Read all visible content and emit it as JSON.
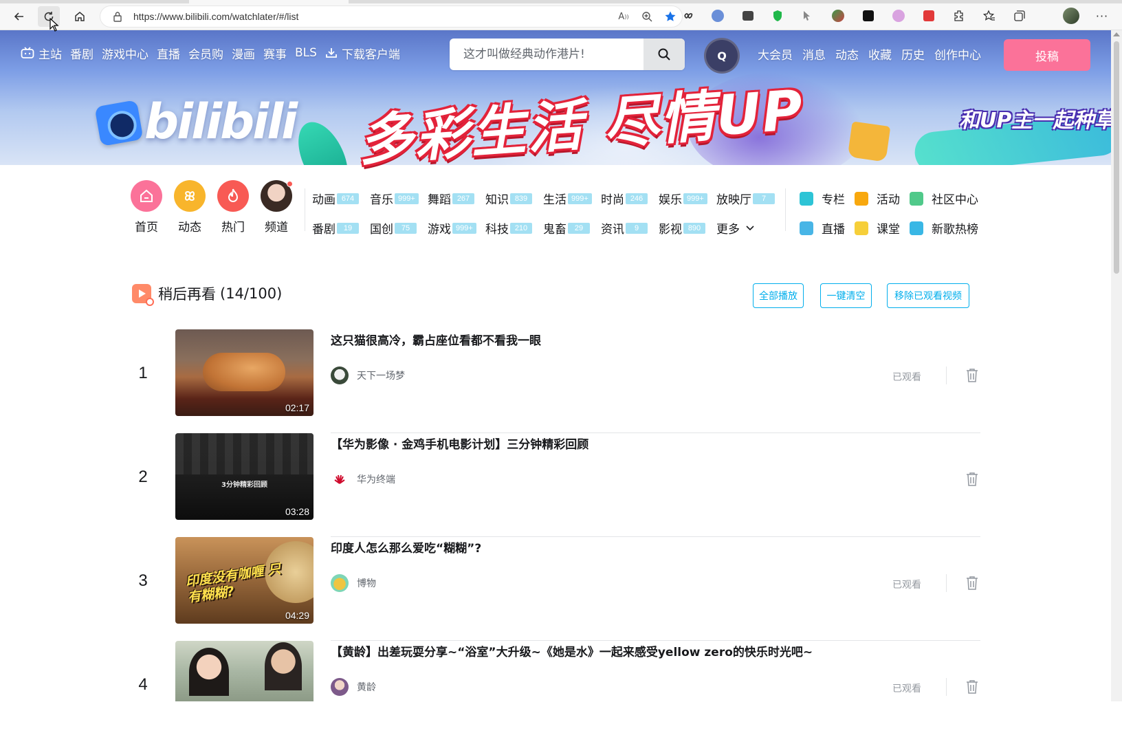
{
  "browser": {
    "url": "https://www.bilibili.com/watchlater/#/list"
  },
  "header": {
    "nav": [
      "主站",
      "番剧",
      "游戏中心",
      "直播",
      "会员购",
      "漫画",
      "赛事",
      "BLS",
      "下载客户端"
    ],
    "search_placeholder": "这才叫做经典动作港片!",
    "right_nav": [
      "大会员",
      "消息",
      "动态",
      "收藏",
      "历史",
      "创作中心"
    ],
    "upload_label": "投稿",
    "banner_logo": "bilibili",
    "banner_slogan": "多彩生活 尽情UP",
    "banner_side": "和UP主一起种草",
    "avatar_text": "Q"
  },
  "quick_links": [
    {
      "label": "首页",
      "color": "#fb7299"
    },
    {
      "label": "动态",
      "color": "#f8b52c"
    },
    {
      "label": "热门",
      "color": "#f85a54"
    },
    {
      "label": "频道",
      "color": "#8a6e62"
    }
  ],
  "categories_row1": [
    {
      "name": "动画",
      "count": "674"
    },
    {
      "name": "音乐",
      "count": "999+"
    },
    {
      "name": "舞蹈",
      "count": "267"
    },
    {
      "name": "知识",
      "count": "839"
    },
    {
      "name": "生活",
      "count": "999+"
    },
    {
      "name": "时尚",
      "count": "246"
    },
    {
      "name": "娱乐",
      "count": "999+"
    },
    {
      "name": "放映厅",
      "count": "7"
    }
  ],
  "categories_row2": [
    {
      "name": "番剧",
      "count": "19"
    },
    {
      "name": "国创",
      "count": "75"
    },
    {
      "name": "游戏",
      "count": "999+"
    },
    {
      "name": "科技",
      "count": "210"
    },
    {
      "name": "鬼畜",
      "count": "29"
    },
    {
      "name": "资讯",
      "count": "9"
    },
    {
      "name": "影视",
      "count": "890"
    }
  ],
  "more_label": "更多",
  "right_links": [
    {
      "label": "专栏",
      "color": "#2dc4d6"
    },
    {
      "label": "活动",
      "color": "#f8a80e"
    },
    {
      "label": "社区中心",
      "color": "#50c98a"
    },
    {
      "label": "直播",
      "color": "#48b5e6"
    },
    {
      "label": "课堂",
      "color": "#f6cf3a"
    },
    {
      "label": "新歌热榜",
      "color": "#39b7e5"
    }
  ],
  "watchlater": {
    "title": "稍后再看",
    "count": "(14/100)",
    "buttons": {
      "play_all": "全部播放",
      "clear": "一键清空",
      "remove_watched": "移除已观看视频"
    },
    "items": [
      {
        "index": "1",
        "title": "这只猫很高冷，霸占座位看都不看我一眼",
        "up": "天下一场梦",
        "duration": "02:17",
        "status": "已观看"
      },
      {
        "index": "2",
        "title": "【华为影像 · 金鸡手机电影计划】三分钟精彩回顾",
        "up": "华为终端",
        "duration": "03:28",
        "status": "",
        "thumb_text": "3分钟精彩回顾"
      },
      {
        "index": "3",
        "title": "印度人怎么那么爱吃“糊糊”?",
        "up": "博物",
        "duration": "04:29",
        "status": "已观看",
        "thumb_text": "印度没有咖喱 只有糊糊?"
      },
      {
        "index": "4",
        "title": "【黄龄】出差玩耍分享~“浴室”大升级~《她是水》一起来感受yellow zero的快乐时光吧~",
        "up": "黄龄",
        "duration": "",
        "status": "已观看"
      }
    ]
  }
}
